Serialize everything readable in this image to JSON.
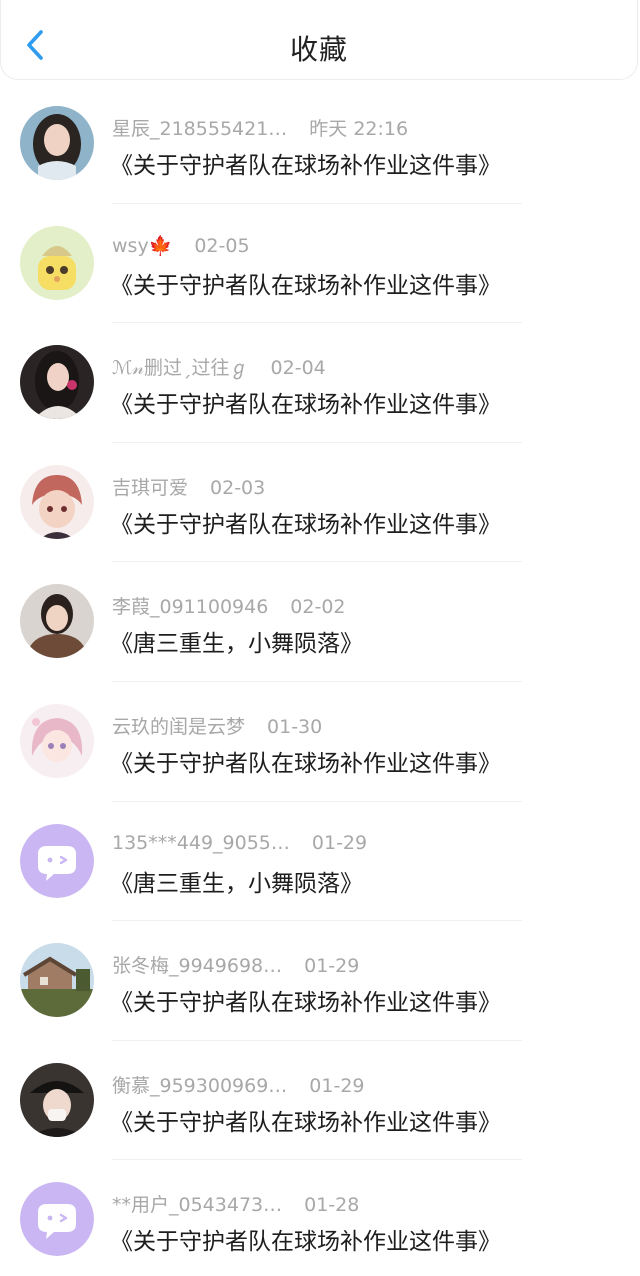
{
  "header": {
    "title": "收藏"
  },
  "items": [
    {
      "name": "星辰_218555421…",
      "time": "昨天 22:16",
      "title": "《关于守护者队在球场补作业这件事》"
    },
    {
      "name": "wsy🍁",
      "time": "02-05",
      "title": "《关于守护者队在球场补作业这件事》"
    },
    {
      "name": "ℳ𝓃删过ˏ过往ℊ",
      "time": "02-04",
      "title": "《关于守护者队在球场补作业这件事》"
    },
    {
      "name": "吉琪可爱",
      "time": "02-03",
      "title": "《关于守护者队在球场补作业这件事》"
    },
    {
      "name": "李葭_091100946",
      "time": "02-02",
      "title": "《唐三重生，小舞陨落》"
    },
    {
      "name": "云玖的闺是云梦",
      "time": "01-30",
      "title": "《关于守护者队在球场补作业这件事》"
    },
    {
      "name": "135***449_9055…",
      "time": "01-29",
      "title": "《唐三重生，小舞陨落》"
    },
    {
      "name": "张冬梅_9949698…",
      "time": "01-29",
      "title": "《关于守护者队在球场补作业这件事》"
    },
    {
      "name": "衡慕_959300969…",
      "time": "01-29",
      "title": "《关于守护者队在球场补作业这件事》"
    },
    {
      "name": "**用户_0543473…",
      "time": "01-28",
      "title": "《关于守护者队在球场补作业这件事》"
    }
  ],
  "icons": {
    "back": "chevron-left-icon",
    "default_avatar": "chat-bubble-icon"
  },
  "colors": {
    "accent": "#2f9cf0",
    "default_avatar_bg": "#c9b6f2",
    "meta_text": "#a8a8a8",
    "title_text": "#1e1e1e"
  }
}
